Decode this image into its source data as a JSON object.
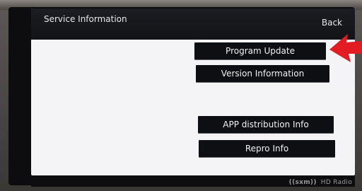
{
  "header": {
    "title": "Service Information",
    "back_label": "Back"
  },
  "menu": {
    "items": [
      {
        "label": "Program Update"
      },
      {
        "label": "Version Information"
      },
      {
        "label": "APP distribution Info"
      },
      {
        "label": "Repro Info"
      }
    ]
  },
  "footer": {
    "sxm_logo": "((sxm))",
    "hd_radio_logo": "HD Radio"
  },
  "colors": {
    "screen_background": "#f4f4f6",
    "header_background": "#121316",
    "button_background": "#0e0f12",
    "button_text": "#f2f2f2",
    "annotation_arrow": "#e31b23"
  },
  "icons": {
    "annotation": "red-arrow-pointer"
  }
}
